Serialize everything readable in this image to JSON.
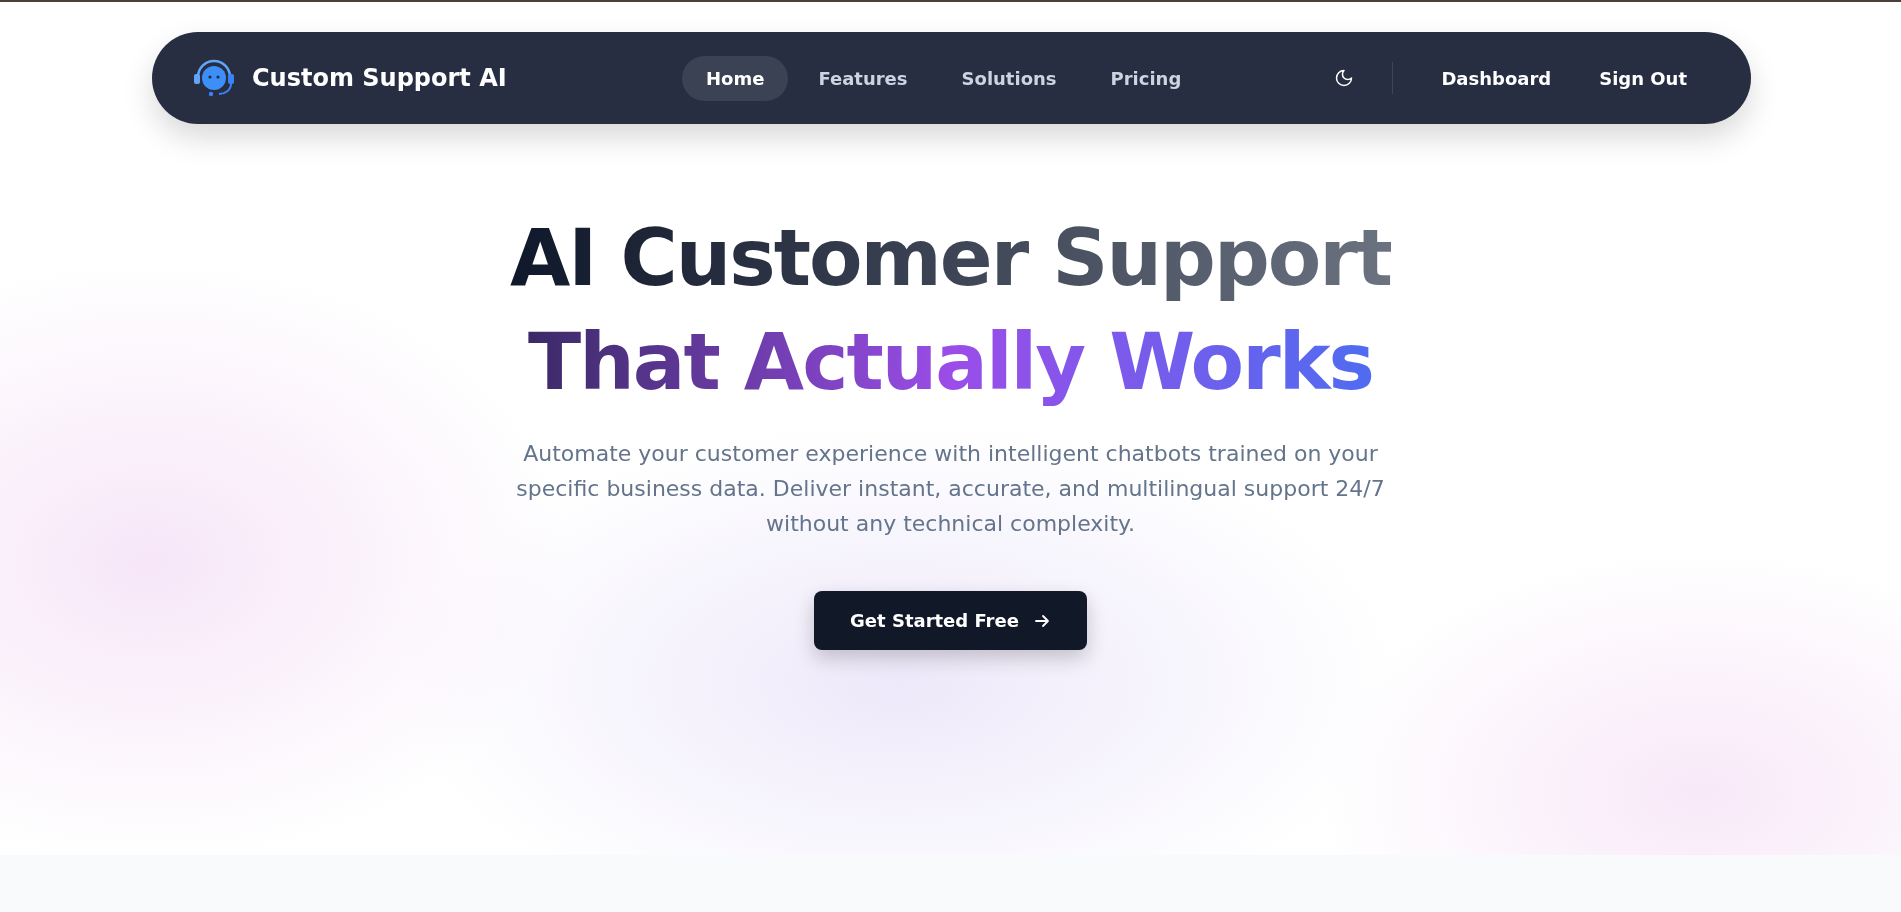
{
  "brand": {
    "name": "Custom Support AI"
  },
  "nav": [
    {
      "label": "Home",
      "selected": true
    },
    {
      "label": "Features",
      "selected": false
    },
    {
      "label": "Solutions",
      "selected": false
    },
    {
      "label": "Pricing",
      "selected": false
    }
  ],
  "actions": [
    "Dashboard",
    "Sign Out"
  ],
  "hero": {
    "title_line_1": "AI Customer Support",
    "title_line_2": "That Actually Works",
    "subtitle": "Automate your customer experience with intelligent chatbots trained on your specific business data. Deliver instant, accurate, and multilingual support 24/7 without any technical complexity.",
    "cta": "Get Started Free"
  }
}
